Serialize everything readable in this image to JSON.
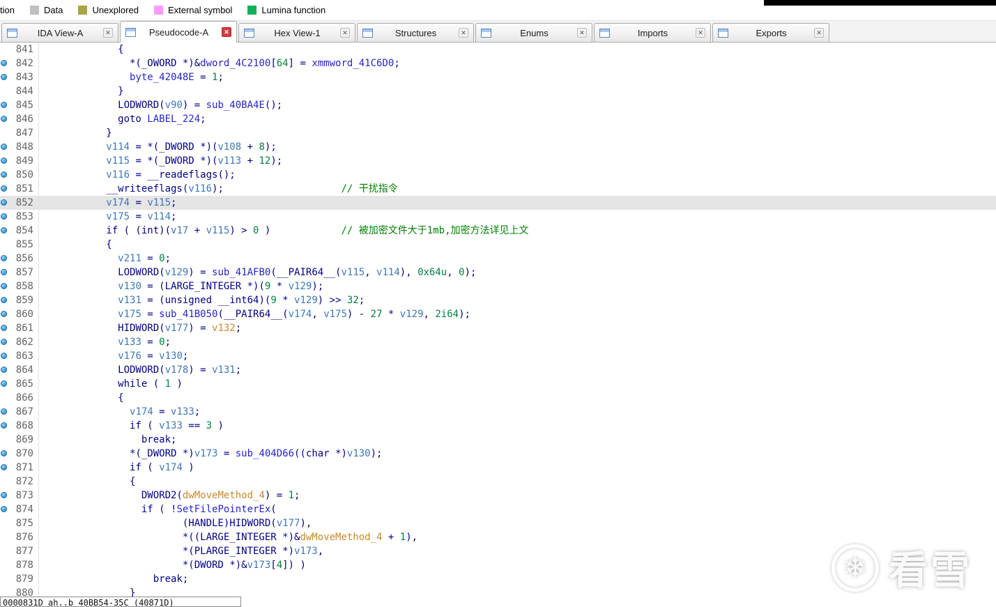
{
  "legend": {
    "clipped_label": "tion",
    "items": [
      {
        "label": "Data",
        "color": "#bfbfbf"
      },
      {
        "label": "Unexplored",
        "color": "#a6a642"
      },
      {
        "label": "External symbol",
        "color": "#ff9aff"
      },
      {
        "label": "Lumina function",
        "color": "#12b05a"
      }
    ]
  },
  "tabs": {
    "items": [
      {
        "label": "IDA View-A",
        "active": false,
        "icon": "ida-view-icon"
      },
      {
        "label": "Pseudocode-A",
        "active": true,
        "icon": "pseudocode-icon"
      },
      {
        "label": "Hex View-1",
        "active": false,
        "icon": "hex-view-icon"
      },
      {
        "label": "Structures",
        "active": false,
        "icon": "structures-icon"
      },
      {
        "label": "Enums",
        "active": false,
        "icon": "enums-icon"
      },
      {
        "label": "Imports",
        "active": false,
        "icon": "imports-icon"
      },
      {
        "label": "Exports",
        "active": false,
        "icon": "exports-icon"
      }
    ],
    "close_glyph": "✕"
  },
  "syntax_colors": {
    "base": "#000086",
    "name": "#2525c8",
    "variable": "#3d77b8",
    "orange": "#c8882a",
    "number": "#008040",
    "comment": "#008000",
    "line_number": "#646464",
    "highlight_bg": "#e5e5e5",
    "close_active": "#d83b3b"
  },
  "footer": {
    "text": "0000831D ah..b 40BB54-35C (40871D)"
  },
  "watermark": {
    "icon": "snowflake-icon",
    "glyph": "❄",
    "text": "看雪"
  },
  "code": {
    "lines": [
      {
        "num": 841,
        "dot": false,
        "segs": [
          [
            "b",
            "            {"
          ]
        ]
      },
      {
        "num": 842,
        "dot": true,
        "segs": [
          [
            "b",
            "              *(_OWORD *)&"
          ],
          [
            "g",
            "dword_4C2100"
          ],
          [
            "b",
            "["
          ],
          [
            "n",
            "64"
          ],
          [
            "b",
            "] = "
          ],
          [
            "g",
            "xmmword_41C6D0"
          ],
          [
            "b",
            ";"
          ]
        ]
      },
      {
        "num": 843,
        "dot": true,
        "segs": [
          [
            "b",
            "              "
          ],
          [
            "g",
            "byte_42048E"
          ],
          [
            "b",
            " = "
          ],
          [
            "n",
            "1"
          ],
          [
            "b",
            ";"
          ]
        ]
      },
      {
        "num": 844,
        "dot": false,
        "segs": [
          [
            "b",
            "            }"
          ]
        ]
      },
      {
        "num": 845,
        "dot": true,
        "segs": [
          [
            "b",
            "            LODWORD("
          ],
          [
            "v",
            "v90"
          ],
          [
            "b",
            ") = "
          ],
          [
            "g",
            "sub_40BA4E"
          ],
          [
            "b",
            "();"
          ]
        ]
      },
      {
        "num": 846,
        "dot": true,
        "segs": [
          [
            "b",
            "            goto "
          ],
          [
            "g",
            "LABEL_224"
          ],
          [
            "b",
            ";"
          ]
        ]
      },
      {
        "num": 847,
        "dot": false,
        "segs": [
          [
            "b",
            "          }"
          ]
        ]
      },
      {
        "num": 848,
        "dot": true,
        "segs": [
          [
            "b",
            "          "
          ],
          [
            "v",
            "v114"
          ],
          [
            "b",
            " = *(_DWORD *)("
          ],
          [
            "v",
            "v108"
          ],
          [
            "b",
            " + "
          ],
          [
            "n",
            "8"
          ],
          [
            "b",
            ");"
          ]
        ]
      },
      {
        "num": 849,
        "dot": true,
        "segs": [
          [
            "b",
            "          "
          ],
          [
            "v",
            "v115"
          ],
          [
            "b",
            " = *(_DWORD *)("
          ],
          [
            "v",
            "v113"
          ],
          [
            "b",
            " + "
          ],
          [
            "n",
            "12"
          ],
          [
            "b",
            ");"
          ]
        ]
      },
      {
        "num": 850,
        "dot": true,
        "segs": [
          [
            "b",
            "          "
          ],
          [
            "v",
            "v116"
          ],
          [
            "b",
            " = __readeflags();"
          ]
        ]
      },
      {
        "num": 851,
        "dot": true,
        "segs": [
          [
            "b",
            "          __writeeflags("
          ],
          [
            "v",
            "v116"
          ],
          [
            "b",
            ");                    "
          ],
          [
            "c",
            "// 干扰指令"
          ]
        ]
      },
      {
        "num": 852,
        "dot": true,
        "hl": true,
        "segs": [
          [
            "b",
            "          "
          ],
          [
            "v",
            "v174"
          ],
          [
            "b",
            " = "
          ],
          [
            "v",
            "v115"
          ],
          [
            "b",
            ";"
          ]
        ]
      },
      {
        "num": 853,
        "dot": true,
        "segs": [
          [
            "b",
            "          "
          ],
          [
            "v",
            "v175"
          ],
          [
            "b",
            " = "
          ],
          [
            "v",
            "v114"
          ],
          [
            "b",
            ";"
          ]
        ]
      },
      {
        "num": 854,
        "dot": true,
        "segs": [
          [
            "b",
            "          if ( (int)("
          ],
          [
            "v",
            "v17"
          ],
          [
            "b",
            " + "
          ],
          [
            "v",
            "v115"
          ],
          [
            "b",
            ") > "
          ],
          [
            "n",
            "0"
          ],
          [
            "b",
            " )            "
          ],
          [
            "c",
            "// 被加密文件大于1mb,加密方法详见上文"
          ]
        ]
      },
      {
        "num": 855,
        "dot": false,
        "segs": [
          [
            "b",
            "          {"
          ]
        ]
      },
      {
        "num": 856,
        "dot": true,
        "segs": [
          [
            "b",
            "            "
          ],
          [
            "v",
            "v211"
          ],
          [
            "b",
            " = "
          ],
          [
            "n",
            "0"
          ],
          [
            "b",
            ";"
          ]
        ]
      },
      {
        "num": 857,
        "dot": true,
        "segs": [
          [
            "b",
            "            LODWORD("
          ],
          [
            "v",
            "v129"
          ],
          [
            "b",
            ") = "
          ],
          [
            "g",
            "sub_41AFB0"
          ],
          [
            "b",
            "(__PAIR64__("
          ],
          [
            "v",
            "v115"
          ],
          [
            "b",
            ", "
          ],
          [
            "v",
            "v114"
          ],
          [
            "b",
            "), "
          ],
          [
            "n",
            "0x64u"
          ],
          [
            "b",
            ", "
          ],
          [
            "n",
            "0"
          ],
          [
            "b",
            ");"
          ]
        ]
      },
      {
        "num": 858,
        "dot": true,
        "segs": [
          [
            "b",
            "            "
          ],
          [
            "v",
            "v130"
          ],
          [
            "b",
            " = (LARGE_INTEGER *)("
          ],
          [
            "n",
            "9"
          ],
          [
            "b",
            " * "
          ],
          [
            "v",
            "v129"
          ],
          [
            "b",
            ");"
          ]
        ]
      },
      {
        "num": 859,
        "dot": true,
        "segs": [
          [
            "b",
            "            "
          ],
          [
            "v",
            "v131"
          ],
          [
            "b",
            " = (unsigned __int64)("
          ],
          [
            "n",
            "9"
          ],
          [
            "b",
            " * "
          ],
          [
            "v",
            "v129"
          ],
          [
            "b",
            ") >> "
          ],
          [
            "n",
            "32"
          ],
          [
            "b",
            ";"
          ]
        ]
      },
      {
        "num": 860,
        "dot": true,
        "segs": [
          [
            "b",
            "            "
          ],
          [
            "v",
            "v175"
          ],
          [
            "b",
            " = "
          ],
          [
            "g",
            "sub_41B050"
          ],
          [
            "b",
            "(__PAIR64__("
          ],
          [
            "v",
            "v174"
          ],
          [
            "b",
            ", "
          ],
          [
            "v",
            "v175"
          ],
          [
            "b",
            ") - "
          ],
          [
            "n",
            "27"
          ],
          [
            "b",
            " * "
          ],
          [
            "v",
            "v129"
          ],
          [
            "b",
            ", "
          ],
          [
            "n",
            "2i64"
          ],
          [
            "b",
            ");"
          ]
        ]
      },
      {
        "num": 861,
        "dot": true,
        "segs": [
          [
            "b",
            "            HIDWORD("
          ],
          [
            "v",
            "v177"
          ],
          [
            "b",
            ") = "
          ],
          [
            "o",
            "v132"
          ],
          [
            "b",
            ";"
          ]
        ]
      },
      {
        "num": 862,
        "dot": true,
        "segs": [
          [
            "b",
            "            "
          ],
          [
            "v",
            "v133"
          ],
          [
            "b",
            " = "
          ],
          [
            "n",
            "0"
          ],
          [
            "b",
            ";"
          ]
        ]
      },
      {
        "num": 863,
        "dot": true,
        "segs": [
          [
            "b",
            "            "
          ],
          [
            "v",
            "v176"
          ],
          [
            "b",
            " = "
          ],
          [
            "v",
            "v130"
          ],
          [
            "b",
            ";"
          ]
        ]
      },
      {
        "num": 864,
        "dot": true,
        "segs": [
          [
            "b",
            "            LODWORD("
          ],
          [
            "v",
            "v178"
          ],
          [
            "b",
            ") = "
          ],
          [
            "v",
            "v131"
          ],
          [
            "b",
            ";"
          ]
        ]
      },
      {
        "num": 865,
        "dot": true,
        "segs": [
          [
            "b",
            "            while ( "
          ],
          [
            "n",
            "1"
          ],
          [
            "b",
            " )"
          ]
        ]
      },
      {
        "num": 866,
        "dot": false,
        "segs": [
          [
            "b",
            "            {"
          ]
        ]
      },
      {
        "num": 867,
        "dot": true,
        "segs": [
          [
            "b",
            "              "
          ],
          [
            "v",
            "v174"
          ],
          [
            "b",
            " = "
          ],
          [
            "v",
            "v133"
          ],
          [
            "b",
            ";"
          ]
        ]
      },
      {
        "num": 868,
        "dot": true,
        "segs": [
          [
            "b",
            "              if ( "
          ],
          [
            "v",
            "v133"
          ],
          [
            "b",
            " == "
          ],
          [
            "n",
            "3"
          ],
          [
            "b",
            " )"
          ]
        ]
      },
      {
        "num": 869,
        "dot": false,
        "segs": [
          [
            "b",
            "                break;"
          ]
        ]
      },
      {
        "num": 870,
        "dot": true,
        "segs": [
          [
            "b",
            "              *(_DWORD *)"
          ],
          [
            "v",
            "v173"
          ],
          [
            "b",
            " = "
          ],
          [
            "g",
            "sub_404D66"
          ],
          [
            "b",
            "((char *)"
          ],
          [
            "v",
            "v130"
          ],
          [
            "b",
            ");"
          ]
        ]
      },
      {
        "num": 871,
        "dot": true,
        "segs": [
          [
            "b",
            "              if ( "
          ],
          [
            "v",
            "v174"
          ],
          [
            "b",
            " )"
          ]
        ]
      },
      {
        "num": 872,
        "dot": false,
        "segs": [
          [
            "b",
            "              {"
          ]
        ]
      },
      {
        "num": 873,
        "dot": true,
        "segs": [
          [
            "b",
            "                DWORD2("
          ],
          [
            "o",
            "dwMoveMethod_4"
          ],
          [
            "b",
            ") = "
          ],
          [
            "n",
            "1"
          ],
          [
            "b",
            ";"
          ]
        ]
      },
      {
        "num": 874,
        "dot": true,
        "segs": [
          [
            "b",
            "                if ( !"
          ],
          [
            "g",
            "SetFilePointerEx"
          ],
          [
            "b",
            "("
          ]
        ]
      },
      {
        "num": 875,
        "dot": false,
        "segs": [
          [
            "b",
            "                       (HANDLE)HIDWORD("
          ],
          [
            "v",
            "v177"
          ],
          [
            "b",
            "),"
          ]
        ]
      },
      {
        "num": 876,
        "dot": false,
        "segs": [
          [
            "b",
            "                       *((LARGE_INTEGER *)&"
          ],
          [
            "o",
            "dwMoveMethod_4"
          ],
          [
            "b",
            " + "
          ],
          [
            "n",
            "1"
          ],
          [
            "b",
            "),"
          ]
        ]
      },
      {
        "num": 877,
        "dot": false,
        "segs": [
          [
            "b",
            "                       *(PLARGE_INTEGER *)"
          ],
          [
            "v",
            "v173"
          ],
          [
            "b",
            ","
          ]
        ]
      },
      {
        "num": 878,
        "dot": false,
        "segs": [
          [
            "b",
            "                       *(DWORD *)&"
          ],
          [
            "v",
            "v173"
          ],
          [
            "b",
            "["
          ],
          [
            "n",
            "4"
          ],
          [
            "b",
            "]) )"
          ]
        ]
      },
      {
        "num": 879,
        "dot": false,
        "segs": [
          [
            "b",
            "                  break;"
          ]
        ]
      },
      {
        "num": 880,
        "dot": false,
        "segs": [
          [
            "b",
            "              }"
          ]
        ]
      }
    ]
  }
}
